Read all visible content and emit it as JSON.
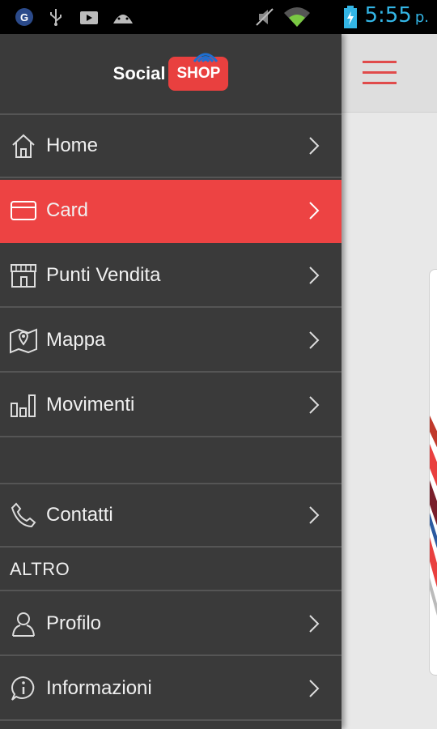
{
  "status_bar": {
    "time": "5:55",
    "time_suffix": "p.",
    "icons": [
      "notification-icon",
      "usb-icon",
      "media-icon",
      "android-icon",
      "mute-icon",
      "wifi-icon",
      "battery-charging-icon"
    ]
  },
  "logo": {
    "word1": "Social",
    "word2": "SHOP"
  },
  "menu": {
    "items": [
      {
        "label": "Home",
        "icon": "home-icon"
      },
      {
        "label": "Card",
        "icon": "card-icon",
        "active": true
      },
      {
        "label": "Punti Vendita",
        "icon": "store-icon"
      },
      {
        "label": "Mappa",
        "icon": "map-icon"
      },
      {
        "label": "Movimenti",
        "icon": "bar-chart-icon"
      }
    ],
    "contact": {
      "label": "Contatti",
      "icon": "phone-icon"
    },
    "section_title": "ALTRO",
    "other_items": [
      {
        "label": "Profilo",
        "icon": "user-icon"
      },
      {
        "label": "Informazioni",
        "icon": "info-icon"
      }
    ]
  },
  "colors": {
    "accent": "#ed4343",
    "drawer_bg": "#3a3a3a",
    "time": "#33b5e5"
  }
}
